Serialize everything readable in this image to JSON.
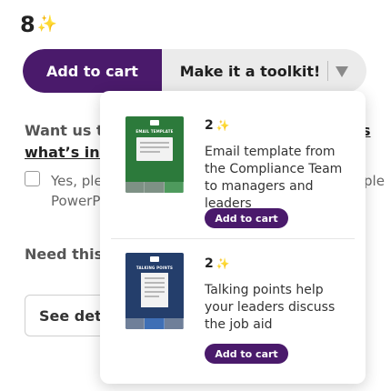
{
  "price": {
    "value": "8",
    "sparkle": "✨"
  },
  "buttons": {
    "add_to_cart": "Add to cart",
    "toolkit": "Make it a toolkit!"
  },
  "background": {
    "want_line": "Want us to",
    "whats_line": "what’s incl",
    "right_fragment": "s",
    "checkbox_label_1": "Yes, plea",
    "checkbox_label_1_tail": "ple",
    "checkbox_label_2": "PowerPo",
    "need_line": "Need this",
    "see_details": "See deta"
  },
  "dropdown": {
    "items": [
      {
        "count": "2",
        "sparkle": "✨",
        "description": "Email template from the Compliance Team to managers and leaders",
        "button": "Add to cart",
        "thumb_title": "EMAIL TEMPLATE"
      },
      {
        "count": "2",
        "sparkle": "✨",
        "description": "Talking points help your leaders discuss the job aid",
        "button": "Add to cart",
        "thumb_title": "TALKING POINTS"
      }
    ]
  },
  "colors": {
    "brand_purple": "#4a1a6b",
    "sparkle": "#f3c64a",
    "thumb_green": "#2c7a3b",
    "thumb_navy": "#243e6b"
  }
}
